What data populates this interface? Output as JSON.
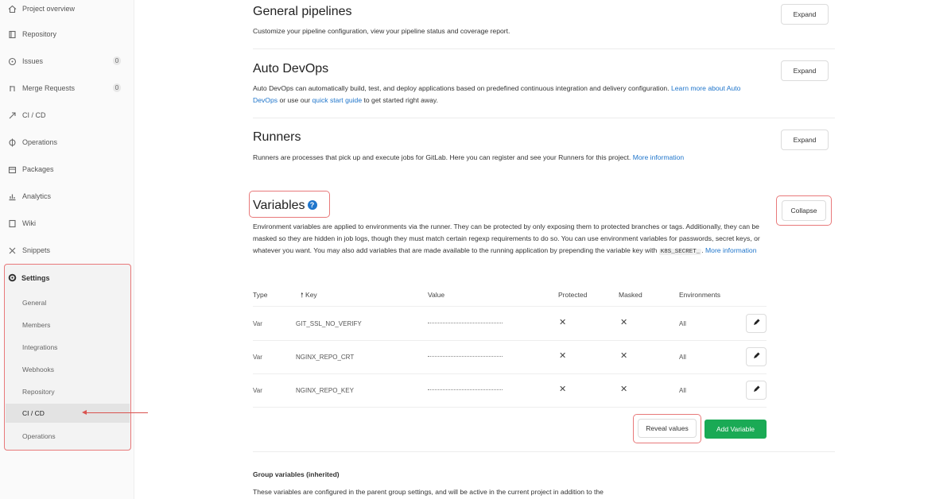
{
  "sidebar": {
    "items": [
      {
        "label": "Project overview",
        "icon": "home-icon"
      },
      {
        "label": "Repository",
        "icon": "book-icon"
      },
      {
        "label": "Issues",
        "icon": "issues-icon",
        "count": "0"
      },
      {
        "label": "Merge Requests",
        "icon": "merge-request-icon",
        "count": "0"
      },
      {
        "label": "CI / CD",
        "icon": "rocket-icon"
      },
      {
        "label": "Operations",
        "icon": "cloud-gear-icon"
      },
      {
        "label": "Packages",
        "icon": "package-icon"
      },
      {
        "label": "Analytics",
        "icon": "chart-icon"
      },
      {
        "label": "Wiki",
        "icon": "wiki-icon"
      },
      {
        "label": "Snippets",
        "icon": "scissors-icon"
      }
    ],
    "settings": {
      "label": "Settings",
      "icon": "gear-icon",
      "subitems": [
        "General",
        "Members",
        "Integrations",
        "Webhooks",
        "Repository",
        "CI / CD",
        "Operations"
      ],
      "active": "CI / CD"
    }
  },
  "sections": {
    "general_pipelines": {
      "title": "General pipelines",
      "desc": "Customize your pipeline configuration, view your pipeline status and coverage report.",
      "button": "Expand"
    },
    "auto_devops": {
      "title": "Auto DevOps",
      "desc_1": "Auto DevOps can automatically build, test, and deploy applications based on predefined continuous integration and delivery configuration.",
      "link_1": "Learn more about Auto DevOps",
      "desc_2": "or use our",
      "link_2": "quick start guide",
      "desc_3": "to get started right away.",
      "button": "Expand"
    },
    "runners": {
      "title": "Runners",
      "desc": "Runners are processes that pick up and execute jobs for GitLab. Here you can register and see your Runners for this project.",
      "link": "More information",
      "button": "Expand"
    },
    "variables": {
      "title": "Variables",
      "help_icon": "question-circle-icon",
      "desc_1": "Environment variables are applied to environments via the runner. They can be protected by only exposing them to protected branches or tags. Additionally, they can be masked so they are hidden in job logs, though they must match certain regexp requirements to do so. You can use environment variables for passwords, secret keys, or whatever you want. You may also add variables that are made available to the running application by prepending the variable key with",
      "code": "K8S_SECRET_",
      "link": "More information",
      "button": "Collapse"
    }
  },
  "table": {
    "headers": {
      "type": "Type",
      "key": "Key",
      "value": "Value",
      "protected": "Protected",
      "masked": "Masked",
      "environments": "Environments"
    },
    "rows": [
      {
        "type": "Var",
        "key": "GIT_SSL_NO_VERIFY",
        "value": "*****************",
        "protected": "✕",
        "masked": "✕",
        "env": "All"
      },
      {
        "type": "Var",
        "key": "NGINX_REPO_CRT",
        "value": "*****************",
        "protected": "✕",
        "masked": "✕",
        "env": "All"
      },
      {
        "type": "Var",
        "key": "NGINX_REPO_KEY",
        "value": "*****************",
        "protected": "✕",
        "masked": "✕",
        "env": "All"
      }
    ],
    "reveal_button": "Reveal values",
    "add_button": "Add Variable"
  },
  "group_variables": {
    "title": "Group variables (inherited)",
    "desc": "These variables are configured in the parent group settings, and will be active in the current project in addition to the"
  },
  "colors": {
    "accent": "#1f75cb",
    "success": "#1aaa55",
    "highlight": "#e8797a"
  }
}
